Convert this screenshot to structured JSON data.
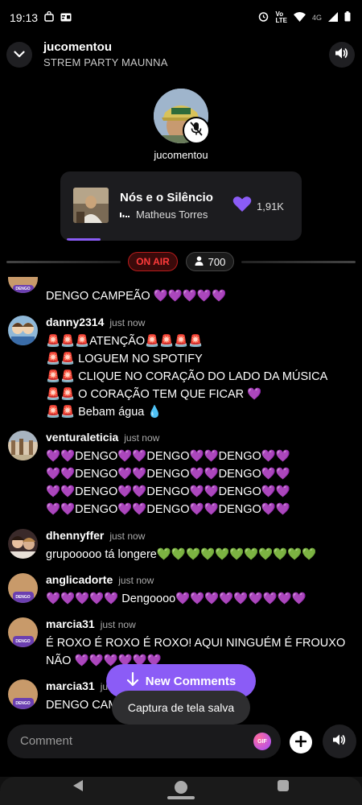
{
  "status_bar": {
    "time": "19:13",
    "network": "4G"
  },
  "header": {
    "title": "jucomentou",
    "subtitle": "STREM PARTY MAUNNA"
  },
  "host": {
    "name": "jucomentou"
  },
  "music": {
    "title": "Nós e o Silêncio",
    "artist": "Matheus Torres",
    "likes": "1,91K",
    "progress": 0.14
  },
  "live": {
    "status": "ON AIR",
    "viewers": "700"
  },
  "comments": [
    {
      "user": "",
      "time": "",
      "lines": [
        "DENGO CAMPEÃO 💜💜💜💜💜"
      ]
    },
    {
      "user": "danny2314",
      "time": "just now",
      "lines": [
        "🚨🚨🚨ATENÇÃO🚨🚨🚨🚨",
        "🚨🚨 LOGUEM NO SPOTIFY",
        "🚨🚨 CLIQUE NO CORAÇÃO DO LADO DA MÚSICA",
        "🚨🚨 O CORAÇÃO TEM QUE FICAR 💜",
        "🚨🚨 Bebam água 💧"
      ]
    },
    {
      "user": "venturaleticia",
      "time": "just now",
      "lines": [
        "💜💜DENGO💜💜DENGO💜💜DENGO💜💜",
        "💜💜DENGO💜💜DENGO💜💜DENGO💜💜",
        "💜💜DENGO💜💜DENGO💜💜DENGO💜💜",
        "💜💜DENGO💜💜DENGO💜💜DENGO💜💜"
      ]
    },
    {
      "user": "dhennyffer",
      "time": "just now",
      "lines": [
        "grupooooo tá longere💚💚💚💚💚💚💚💚💚💚💚"
      ]
    },
    {
      "user": "anglicadorte",
      "time": "just now",
      "lines": [
        "💜💜💜💜💜 Dengoooo💜💜💜💜💜💜💜💜💜"
      ]
    },
    {
      "user": "marcia31",
      "time": "just now",
      "lines": [
        "É ROXO É ROXO É ROXO! AQUI NINGUÉM É FROUXO",
        "NÃO 💜💜💜💜💜💜"
      ]
    },
    {
      "user": "marcia31",
      "time": "just now",
      "lines": [
        "DENGO CAMPEÃO"
      ]
    }
  ],
  "new_comments_label": "New Comments",
  "toast": "Captura de tela salva",
  "comment_input": {
    "placeholder": "Comment",
    "gif_label": "GIF"
  },
  "colors": {
    "accent": "#8b5cf6",
    "on_air": "#ff3b3b",
    "background": "#000000"
  }
}
